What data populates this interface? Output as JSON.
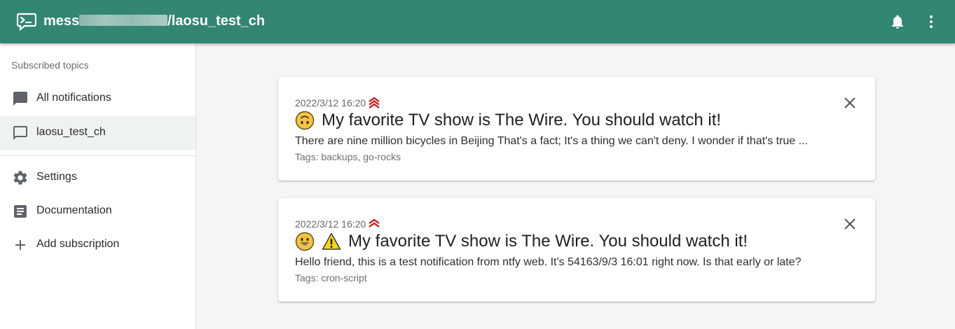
{
  "appbar": {
    "title_prefix": "mess",
    "title_suffix": "/laosu_test_ch",
    "background": "#338574",
    "icons": [
      "terminal-icon",
      "bell-icon",
      "more-vert-icon"
    ]
  },
  "sidebar": {
    "header": "Subscribed topics",
    "items": [
      {
        "label": "All notifications",
        "icon": "chat-icon"
      },
      {
        "label": "laosu_test_ch",
        "icon": "chat-outline-icon",
        "selected": true
      },
      {
        "label": "Settings",
        "icon": "gear-icon"
      },
      {
        "label": "Documentation",
        "icon": "document-icon"
      },
      {
        "label": "Add subscription",
        "icon": "plus-icon"
      }
    ]
  },
  "notifications": [
    {
      "date": "2022/3/12 16:20",
      "priority": "max",
      "emojis": [
        "upside-down-face"
      ],
      "title": "My favorite TV show is The Wire. You should watch it!",
      "message": "There are nine million bicycles in Beijing That's a fact; It's a thing we can't deny. I wonder if that's true ...",
      "tags": "Tags: backups, go-rocks"
    },
    {
      "date": "2022/3/12 16:20",
      "priority": "high",
      "emojis": [
        "grinning-face",
        "warning"
      ],
      "title": "My favorite TV show is The Wire. You should watch it!",
      "message": "Hello friend, this is a test notification from ntfy web. It's 54163/9/3 16:01 right now. Is that early or late?",
      "tags": "Tags: cron-script"
    }
  ],
  "colors": {
    "priority": "#c62828",
    "emoji": "#f6c445",
    "warning": "#f7d417"
  }
}
